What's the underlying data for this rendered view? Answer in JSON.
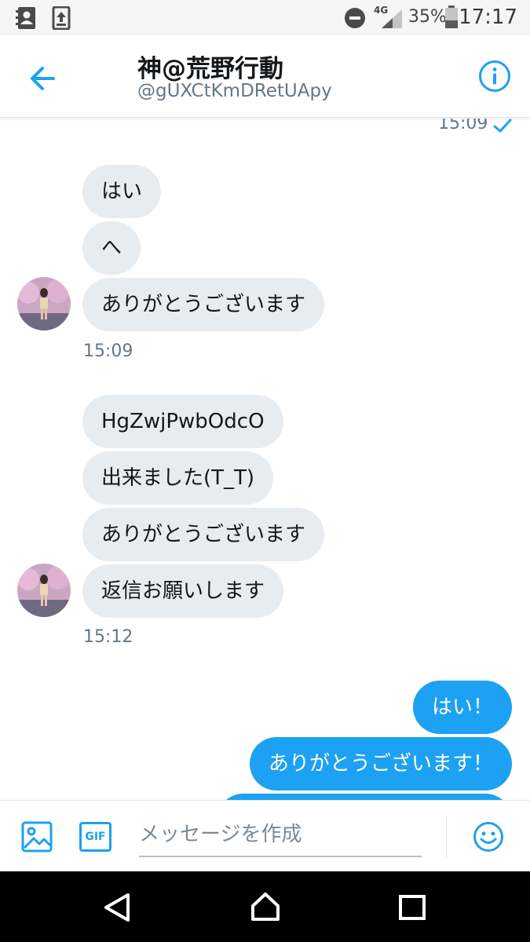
{
  "status_bar": {
    "network": "4G",
    "battery": "35%",
    "time": "17:17"
  },
  "header": {
    "title": "神@荒野行動",
    "handle": "@gUXCtKmDRetUApy"
  },
  "conversation": {
    "top_timestamp": "15:09",
    "groups": [
      {
        "messages": [
          "はい",
          "へ",
          "ありがとうございます"
        ],
        "timestamp": "15:09"
      },
      {
        "messages": [
          "HgZwjPwbOdcO",
          "出来ました(T_T)",
          "ありがとうございます",
          "返信お願いします"
        ],
        "timestamp": "15:12"
      }
    ],
    "sent_messages": [
      "はい！",
      "ありがとうございます！"
    ]
  },
  "composer": {
    "placeholder": "メッセージを作成",
    "gif_label": "GIF"
  },
  "colors": {
    "accent": "#1da1f2",
    "incoming_bubble": "#e6ecf0",
    "secondary_text": "#657786"
  },
  "icons": {
    "back": "arrow-left-icon",
    "info": "info-icon",
    "photo": "image-icon",
    "gif": "gif-icon",
    "emoji": "smiley-icon"
  }
}
